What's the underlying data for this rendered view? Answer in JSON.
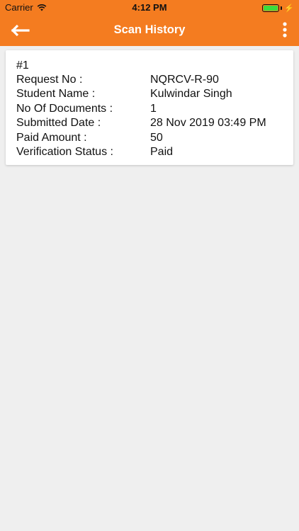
{
  "status_bar": {
    "carrier": "Carrier",
    "time": "4:12 PM",
    "battery_level_percent": 100
  },
  "nav": {
    "title": "Scan History",
    "back_icon": "arrow-left-icon",
    "more_icon": "vertical-dots-icon"
  },
  "colors": {
    "accent": "#f47c20",
    "background": "#efefef",
    "card": "#ffffff"
  },
  "history": [
    {
      "index": "#1",
      "fields": [
        {
          "label": "Request No :",
          "value": "NQRCV-R-90"
        },
        {
          "label": "Student Name :",
          "value": "Kulwindar Singh"
        },
        {
          "label": "No Of Documents :",
          "value": "1"
        },
        {
          "label": "Submitted Date :",
          "value": "28 Nov 2019 03:49 PM"
        },
        {
          "label": "Paid Amount :",
          "value": "50"
        },
        {
          "label": "Verification Status :",
          "value": "Paid"
        }
      ]
    }
  ]
}
